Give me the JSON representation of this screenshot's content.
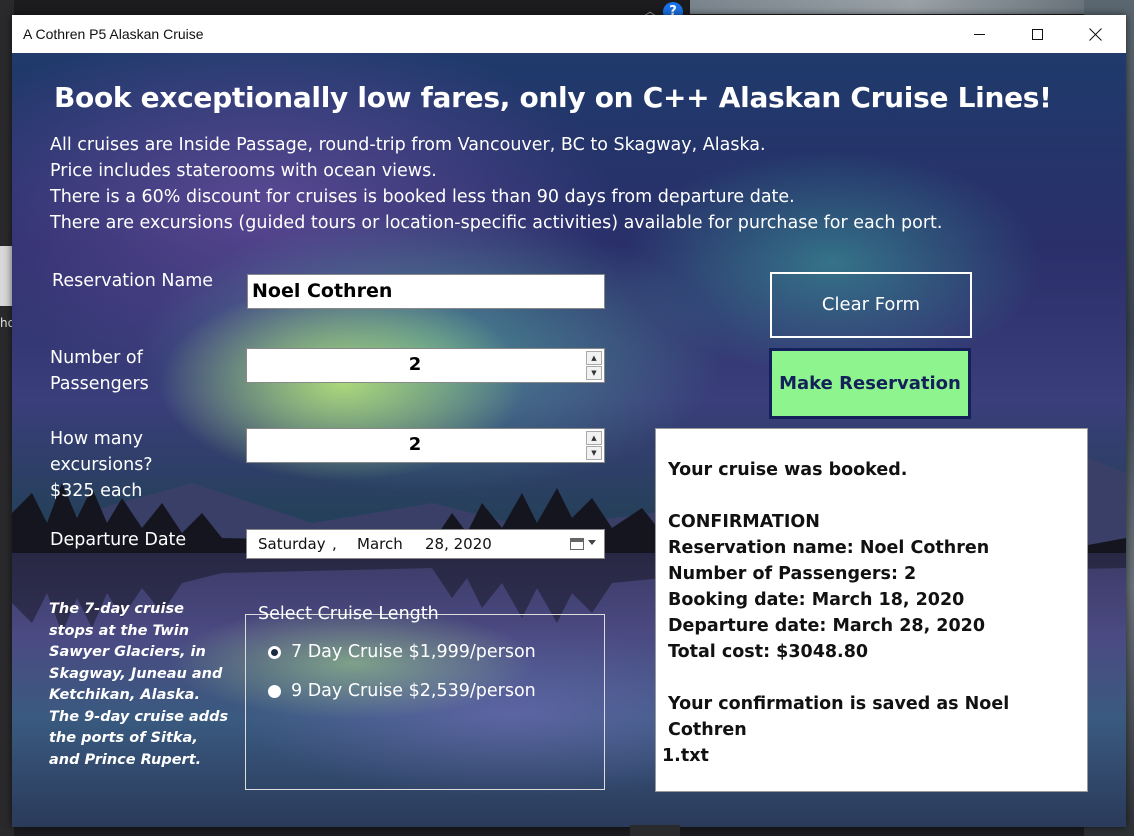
{
  "desktop": {
    "partial_text": "ho",
    "help_glyph": "?",
    "chevron": "︿"
  },
  "window": {
    "title": "A Cothren P5 Alaskan Cruise"
  },
  "headline": "Book exceptionally low fares, only on C++ Alaskan Cruise Lines!",
  "info_lines": [
    "All cruises are Inside Passage, round-trip from Vancouver, BC to Skagway, Alaska.",
    "Price includes staterooms with ocean views.",
    "There is a 60% discount for cruises is booked less than 90 days from departure date.",
    "There are excursions (guided tours or location-specific activities) available for purchase for each port."
  ],
  "form": {
    "reservation_name_label": "Reservation Name",
    "reservation_name_value": "Noel Cothren",
    "passengers_label_1": "Number of",
    "passengers_label_2": "Passengers",
    "passengers_value": "2",
    "excursions_label_1": "How many",
    "excursions_label_2": "excursions?",
    "excursions_label_3": "$325 each",
    "excursions_value": "2",
    "departure_label": "Departure Date",
    "departure_day": "Saturday",
    "departure_sep": ",",
    "departure_month": "March",
    "departure_rest": "28, 2020"
  },
  "note": "The 7-day cruise  stops at the Twin Sawyer Glaciers, in Skagway, Juneau and Ketchikan, Alaska.  The 9-day cruise adds the ports of Sitka, and Prince Rupert.",
  "cruise_length": {
    "title": "Select Cruise Length",
    "options": [
      {
        "label": "7 Day Cruise $1,999/person",
        "selected": true
      },
      {
        "label": "9 Day Cruise $2,539/person",
        "selected": false
      }
    ]
  },
  "buttons": {
    "clear": "Clear Form",
    "make": "Make Reservation"
  },
  "output": {
    "lines": [
      "Your cruise was booked.",
      "",
      "CONFIRMATION",
      "Reservation name: Noel Cothren",
      "Number of Passengers: 2",
      "Booking date: March 18, 2020",
      "Departure date: March 28, 2020",
      "Total cost: $3048.80",
      "",
      "Your confirmation is saved as Noel Cothren",
      "1.txt"
    ]
  },
  "colors": {
    "make_button_bg": "#8ef58e",
    "make_button_border": "#14205a"
  }
}
